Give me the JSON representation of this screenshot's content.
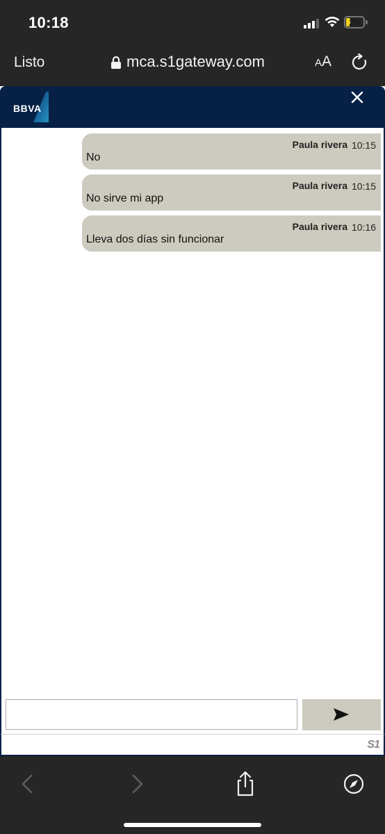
{
  "status_bar": {
    "time": "10:18",
    "battery": "25",
    "battery_level": 0.25,
    "icons": [
      "cellular-signal-icon",
      "wifi-icon",
      "battery-icon"
    ]
  },
  "browser": {
    "done_label": "Listo",
    "url": "mca.s1gateway.com",
    "text_size_label_big": "A",
    "text_size_label_small": "A",
    "icons": [
      "lock-icon",
      "text-size-icon",
      "reload-icon"
    ]
  },
  "chat": {
    "brand": "BBVA",
    "messages": [
      {
        "sender": "Paula rivera",
        "time": "10:15",
        "text": "No"
      },
      {
        "sender": "Paula rivera",
        "time": "10:15",
        "text": "No sirve mi app"
      },
      {
        "sender": "Paula rivera",
        "time": "10:16",
        "text": "Lleva dos días sin funcionar"
      }
    ],
    "input": {
      "value": "",
      "placeholder": ""
    },
    "footer_brand": "S1",
    "colors": {
      "header": "#072146",
      "bubble": "#cdcbbf"
    }
  },
  "toolbar": {
    "icons": [
      "back-icon",
      "forward-icon",
      "share-icon",
      "compass-icon"
    ]
  }
}
